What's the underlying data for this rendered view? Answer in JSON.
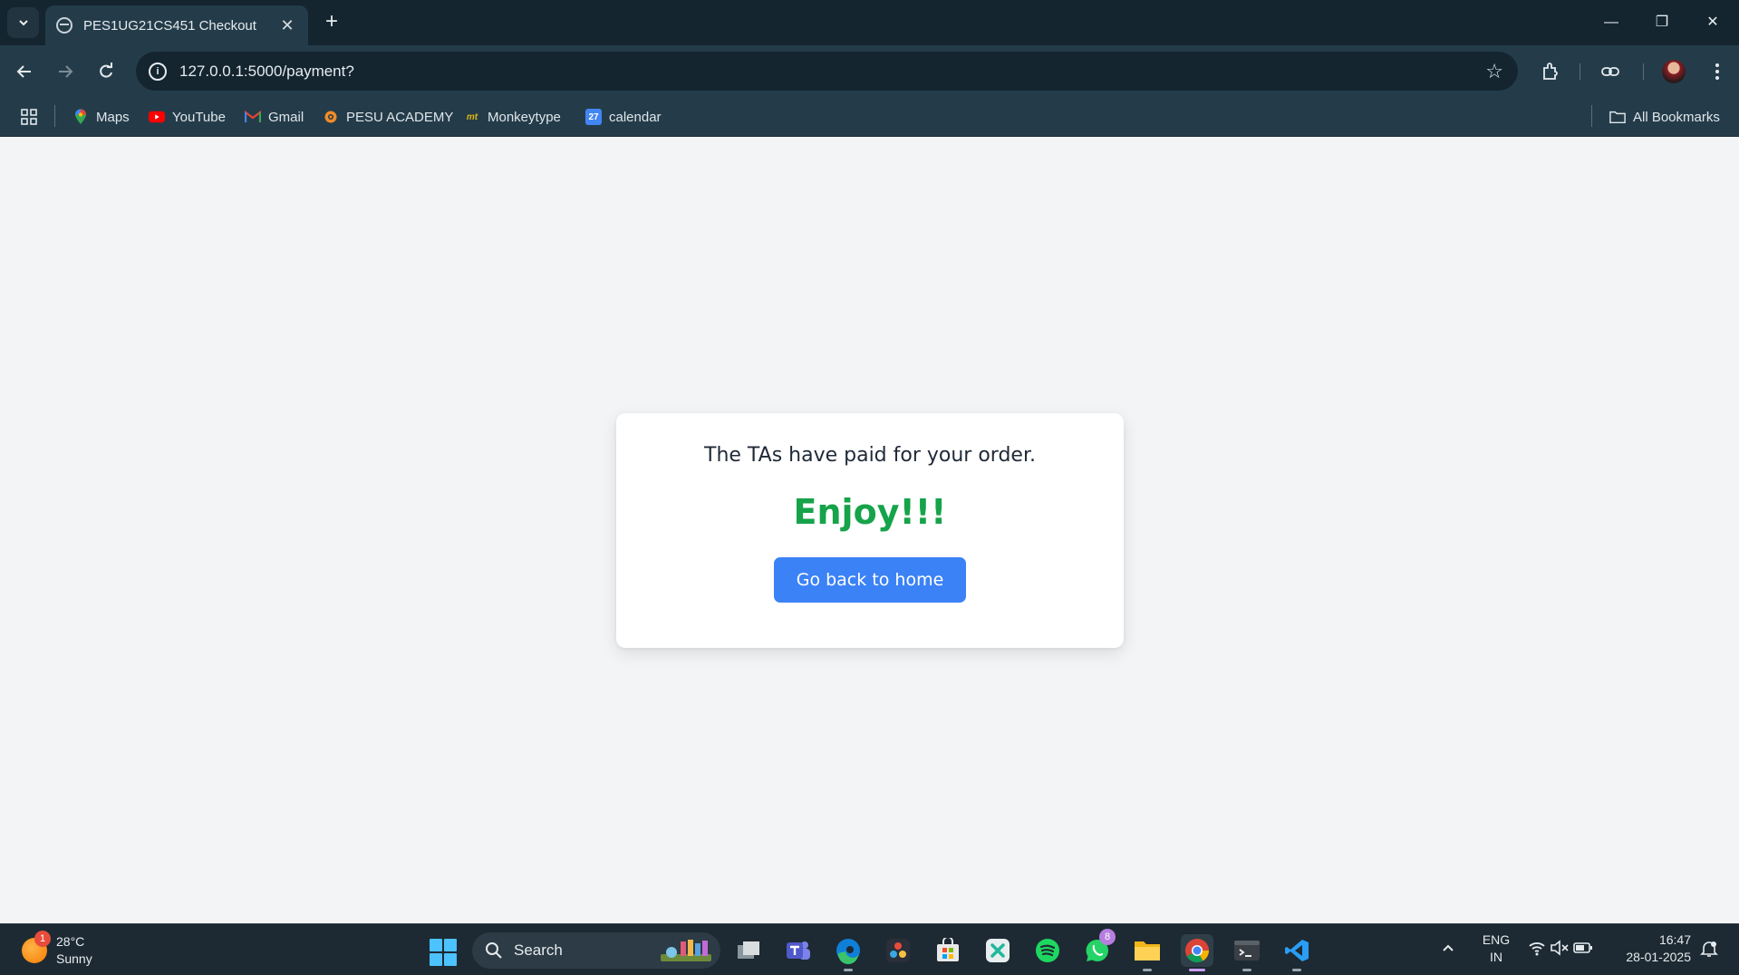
{
  "browser": {
    "tab": {
      "title": "PES1UG21CS451 Checkout"
    },
    "address_bar": {
      "url": "127.0.0.1:5000/payment?"
    },
    "bookmarks": [
      {
        "label": "Maps",
        "icon": "maps-icon"
      },
      {
        "label": "YouTube",
        "icon": "youtube-icon"
      },
      {
        "label": "Gmail",
        "icon": "gmail-icon"
      },
      {
        "label": "PESU ACADEMY",
        "icon": "pesu-icon"
      },
      {
        "label": "Monkeytype",
        "icon": "monkeytype-icon",
        "icon_text": "mt"
      },
      {
        "label": "calendar",
        "icon": "calendar-icon",
        "icon_text": "27"
      }
    ],
    "all_bookmarks_label": "All Bookmarks"
  },
  "page": {
    "message": "The TAs have paid for your order.",
    "headline": "Enjoy!!!",
    "home_button_label": "Go back to home",
    "colors": {
      "background": "#f3f4f6",
      "headline": "#16a34a",
      "button": "#3b82f6"
    }
  },
  "taskbar": {
    "weather": {
      "temperature": "28°C",
      "condition": "Sunny",
      "badge": "1"
    },
    "search_label": "Search",
    "apps": [
      {
        "name": "task-view-icon"
      },
      {
        "name": "teams-icon"
      },
      {
        "name": "edge-icon"
      },
      {
        "name": "davinci-resolve-icon"
      },
      {
        "name": "microsoft-store-icon"
      },
      {
        "name": "xmind-icon"
      },
      {
        "name": "spotify-icon"
      },
      {
        "name": "whatsapp-icon",
        "badge": "8"
      },
      {
        "name": "file-explorer-icon"
      },
      {
        "name": "chrome-icon",
        "active": true
      },
      {
        "name": "terminal-icon"
      },
      {
        "name": "vscode-icon"
      }
    ],
    "language": {
      "line1": "ENG",
      "line2": "IN"
    },
    "clock": {
      "time": "16:47",
      "date": "28-01-2025"
    }
  }
}
